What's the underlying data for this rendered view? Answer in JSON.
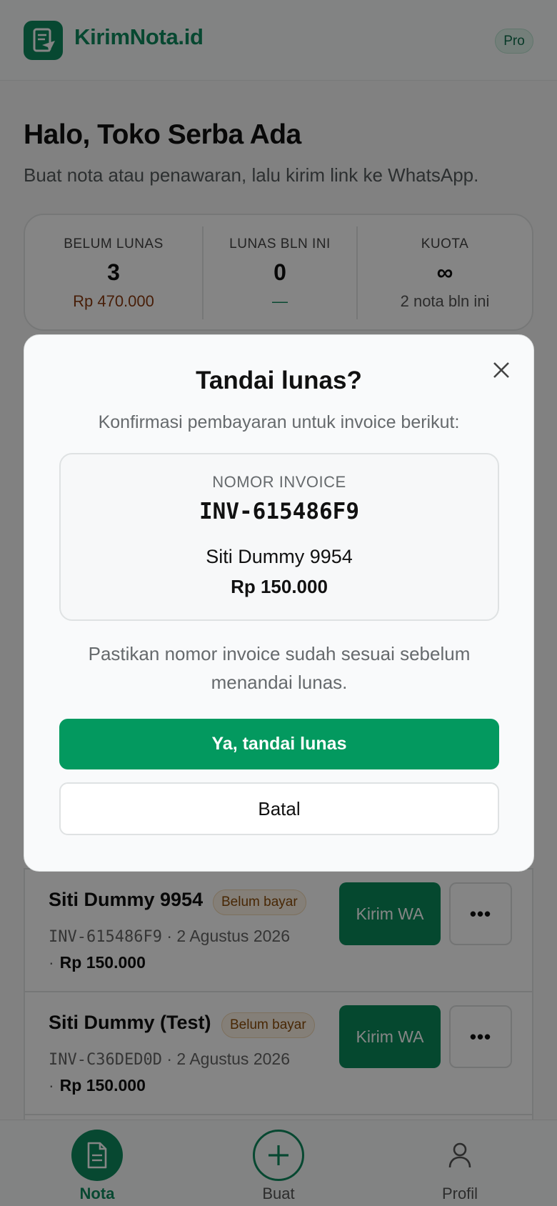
{
  "header": {
    "brand": "KirimNota.id",
    "plan_badge": "Pro",
    "logo_icon": "nota-send-icon"
  },
  "greeting": {
    "title": "Halo, Toko Serba Ada",
    "subtitle": "Buat nota atau penawaran, lalu kirim link ke WhatsApp."
  },
  "stats": [
    {
      "label": "BELUM LUNAS",
      "value": "3",
      "detail": "Rp 470.000",
      "detail_color": "#8a3a10"
    },
    {
      "label": "LUNAS BLN INI",
      "value": "0",
      "detail": "—",
      "detail_color": "#0f8a5f"
    },
    {
      "label": "KUOTA",
      "value": "∞",
      "detail": "2 nota bln ini",
      "detail_color": "#555555"
    }
  ],
  "invoices": [
    {
      "customer": "Siti Dummy 9954",
      "status": "Belum bayar",
      "number": "INV-615486F9",
      "date": "2 Agustus 2026",
      "amount": "Rp 150.000",
      "send_label": "Kirim WA",
      "more_label": "•••"
    },
    {
      "customer": "Siti Dummy (Test)",
      "status": "Belum bayar",
      "number": "INV-C36DED0D",
      "date": "2 Agustus 2026",
      "amount": "Rp 150.000",
      "send_label": "Kirim WA",
      "more_label": "•••"
    }
  ],
  "separator": "·",
  "nav": [
    {
      "label": "Nota",
      "icon": "document-icon",
      "active": true
    },
    {
      "label": "Buat",
      "icon": "plus-circle-icon",
      "active": false
    },
    {
      "label": "Profil",
      "icon": "user-icon",
      "active": false
    }
  ],
  "modal": {
    "title": "Tandai lunas?",
    "subtitle": "Konfirmasi pembayaran untuk invoice berikut:",
    "invoice_label": "NOMOR INVOICE",
    "invoice_number": "INV-615486F9",
    "customer": "Siti Dummy 9954",
    "amount": "Rp 150.000",
    "note": "Pastikan nomor invoice sudah sesuai sebelum menandai lunas.",
    "confirm_label": "Ya, tandai lunas",
    "cancel_label": "Batal"
  },
  "colors": {
    "brand": "#0f8a5f",
    "confirm": "#03995f",
    "overlay": "rgba(0,0,0,0.48)"
  }
}
